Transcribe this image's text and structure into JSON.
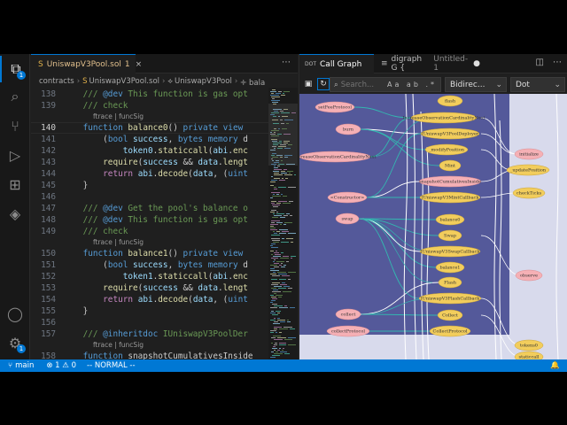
{
  "activity_bar": {
    "items": [
      {
        "name": "explorer",
        "glyph": "⧉",
        "badge": "1",
        "active": true
      },
      {
        "name": "search",
        "glyph": "⌕"
      },
      {
        "name": "source-control",
        "glyph": "⑂"
      },
      {
        "name": "run-debug",
        "glyph": "▷"
      },
      {
        "name": "extensions",
        "glyph": "⊞"
      },
      {
        "name": "ethereum",
        "glyph": "◈"
      }
    ],
    "account_glyph": "◯",
    "settings_glyph": "⚙",
    "settings_badge": "1"
  },
  "left_editor": {
    "tab": {
      "label": "UniswapV3Pool.sol",
      "suffix": "1",
      "close": "×",
      "icon": "S"
    },
    "more": "⋯",
    "breadcrumb": [
      "contracts",
      "UniswapV3Pool.sol",
      "UniswapV3Pool",
      "🝊 bala"
    ],
    "lines": [
      {
        "num": "138",
        "code": "    /// @dev This function is gas opt",
        "kind": "comment"
      },
      {
        "num": "139",
        "code": "    /// check",
        "kind": "comment"
      },
      {
        "lens": "ftrace | funcSig"
      },
      {
        "num": "140",
        "current": true,
        "kind": "fn",
        "parts": [
          "    ",
          "function",
          " ",
          "balance0",
          "() ",
          "private",
          " ",
          "view"
        ]
      },
      {
        "num": "141",
        "code": "        (bool success, bytes memory d",
        "kind": "decl"
      },
      {
        "num": "142",
        "code": "            token0.staticcall(abi.enc",
        "kind": "call"
      },
      {
        "num": "143",
        "code": "        require(success && data.lengt",
        "kind": "require"
      },
      {
        "num": "144",
        "code": "        return abi.decode(data, (uint",
        "kind": "return"
      },
      {
        "num": "145",
        "code": "    }",
        "kind": "plain"
      },
      {
        "num": "146",
        "code": "",
        "kind": "plain"
      },
      {
        "num": "147",
        "code": "    /// @dev Get the pool's balance o",
        "kind": "comment"
      },
      {
        "num": "148",
        "code": "    /// @dev This function is gas opt",
        "kind": "comment"
      },
      {
        "num": "149",
        "code": "    /// check",
        "kind": "comment"
      },
      {
        "lens": "ftrace | funcSig"
      },
      {
        "num": "150",
        "kind": "fn",
        "parts": [
          "    ",
          "function",
          " ",
          "balance1",
          "() ",
          "private",
          " ",
          "view"
        ]
      },
      {
        "num": "151",
        "code": "        (bool success, bytes memory d",
        "kind": "decl"
      },
      {
        "num": "152",
        "code": "            token1.staticcall(abi.enc",
        "kind": "call"
      },
      {
        "num": "153",
        "code": "        require(success && data.lengt",
        "kind": "require"
      },
      {
        "num": "154",
        "code": "        return abi.decode(data, (uint",
        "kind": "return"
      },
      {
        "num": "155",
        "code": "    }",
        "kind": "plain"
      },
      {
        "num": "156",
        "code": "",
        "kind": "plain"
      },
      {
        "num": "157",
        "code": "    /// @inheritdoc IUniswapV3PoolDer",
        "kind": "comment"
      },
      {
        "lens": "ftrace | funcSig"
      },
      {
        "num": "158",
        "code": "    function snapshotCumulativesInside",
        "kind": "plain"
      }
    ]
  },
  "right_editor": {
    "tabs": [
      {
        "label": "Call Graph",
        "icon": "DOT",
        "active": true
      },
      {
        "label": "digraph G {",
        "icon": "≡",
        "extra": "Untitled-1",
        "dot": "●"
      }
    ],
    "actions": [
      "◫",
      "⋯"
    ],
    "toolbar": {
      "save_glyph": "▣",
      "refresh_glyph": "↻",
      "search_placeholder": "Search...",
      "search_opts": "Aa ab .*",
      "direction": "Bidirec...",
      "layout": "Dot"
    }
  },
  "graph": {
    "nodes": [
      {
        "label": "flash",
        "kind": "yellow"
      },
      {
        "label": "setFeeProtocol",
        "kind": "pink"
      },
      {
        "label": "IncreaseObservationCardinalityNext",
        "kind": "yellow"
      },
      {
        "label": "burn",
        "kind": "pink"
      },
      {
        "label": "IUniswapV3PoolDeployer",
        "kind": "yellow"
      },
      {
        "label": "_modifyPosition",
        "kind": "yellow"
      },
      {
        "label": "increaseObservationCardinalityNext",
        "kind": "pink"
      },
      {
        "label": "Mint",
        "kind": "yellow"
      },
      {
        "label": "snapshotCumulativesInside",
        "kind": "pink"
      },
      {
        "label": "IUniswapV3MintCallback",
        "kind": "yellow"
      },
      {
        "label": "<Constructor>",
        "kind": "pink"
      },
      {
        "label": "swap",
        "kind": "pink"
      },
      {
        "label": "balance0",
        "kind": "yellow"
      },
      {
        "label": "Swap",
        "kind": "yellow"
      },
      {
        "label": "IUniswapV3SwapCallback",
        "kind": "yellow"
      },
      {
        "label": "balance1",
        "kind": "yellow"
      },
      {
        "label": "Flash",
        "kind": "yellow"
      },
      {
        "label": "IUniswapV3FlashCallback",
        "kind": "yellow"
      },
      {
        "label": "collect",
        "kind": "pink"
      },
      {
        "label": "Collect",
        "kind": "yellow"
      },
      {
        "label": "collectProtocol",
        "kind": "pink"
      },
      {
        "label": "CollectProtocol",
        "kind": "yellow"
      },
      {
        "label": "initialize",
        "kind": "pink"
      },
      {
        "label": "_updatePosition",
        "kind": "yellow"
      },
      {
        "label": "checkTicks",
        "kind": "yellow"
      },
      {
        "label": "observe",
        "kind": "pink"
      },
      {
        "label": "tokens0",
        "kind": "yellow"
      },
      {
        "label": "staticcall",
        "kind": "yellow"
      }
    ]
  },
  "statusbar": {
    "branch": "main",
    "branch_icon": "⑂",
    "problems": "⊗ 1 ⚠ 0",
    "mode": "-- NORMAL --",
    "right": [
      "🔔"
    ]
  },
  "colors": {
    "accent": "#0078d4",
    "graph_bg": "#d8daec",
    "pink_node": "#f5b0b5",
    "yellow_node": "#f2cd5c",
    "edge_cyan": "#33b7b0",
    "edge_white": "#ffffff"
  }
}
